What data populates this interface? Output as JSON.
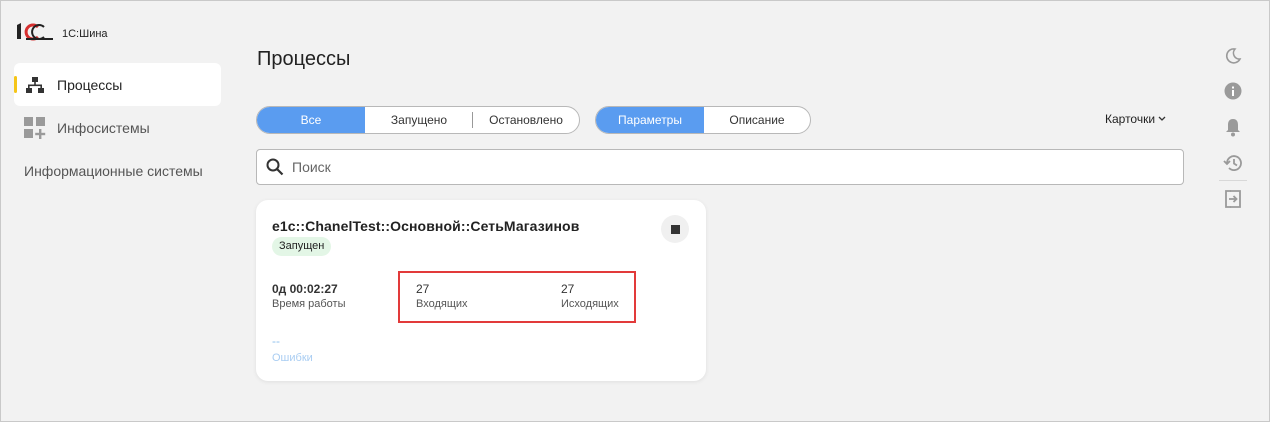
{
  "app": {
    "logo_text": "1С:Шина"
  },
  "sidebar": {
    "items": [
      {
        "label": "Процессы",
        "icon": "hierarchy-icon",
        "active": true
      },
      {
        "label": "Инфосистемы",
        "icon": "grid-plus-icon",
        "active": false
      }
    ],
    "sub_label": "Информационные системы"
  },
  "main": {
    "title": "Процессы",
    "status_filter": {
      "options": [
        "Все",
        "Запущено",
        "Остановлено"
      ],
      "selected": "Все"
    },
    "view_tabs": {
      "options": [
        "Параметры",
        "Описание"
      ],
      "selected": "Параметры"
    },
    "view_mode": {
      "label": "Карточки"
    },
    "search": {
      "placeholder": "Поиск",
      "value": ""
    }
  },
  "card": {
    "title": "e1c::ChanelTest::Основной::СетьМагазинов",
    "status": "Запущен",
    "uptime": {
      "value": "0д 00:02:27",
      "label": "Время работы"
    },
    "incoming": {
      "value": "27",
      "label": "Входящих"
    },
    "outgoing": {
      "value": "27",
      "label": "Исходящих"
    },
    "errors": {
      "value": "--",
      "label": "Ошибки"
    }
  },
  "rail": [
    "moon-icon",
    "info-icon",
    "bell-icon",
    "history-icon",
    "logout-icon"
  ],
  "colors": {
    "accent": "#5a9cf0",
    "active_marker": "#f5c518",
    "highlight": "#e23a3a",
    "badge_bg": "#e3f6e6"
  }
}
